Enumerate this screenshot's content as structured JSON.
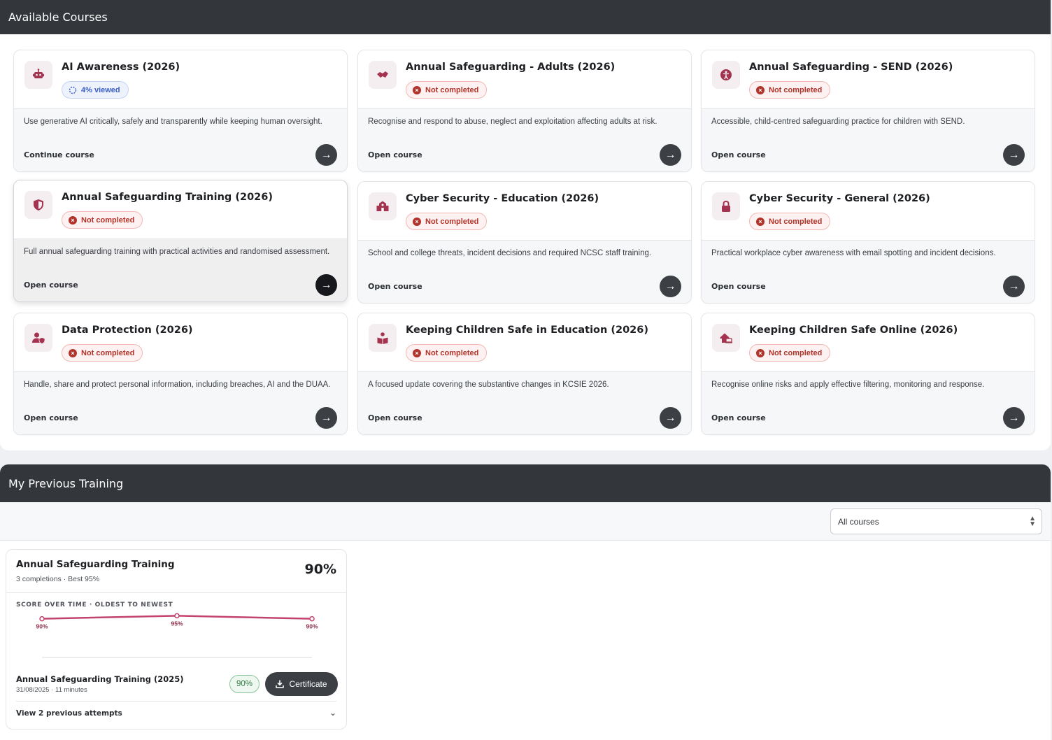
{
  "available": {
    "title": "Available Courses",
    "courses": [
      {
        "title": "AI Awareness (2026)",
        "status": "4% viewed",
        "status_type": "progress",
        "icon": "robot-icon",
        "description": "Use generative AI critically, safely and transparently while keeping human oversight.",
        "action": "Continue course"
      },
      {
        "title": "Annual Safeguarding - Adults (2026)",
        "status": "Not completed",
        "status_type": "not-completed",
        "icon": "handshake-icon",
        "description": "Recognise and respond to abuse, neglect and exploitation affecting adults at risk.",
        "action": "Open course"
      },
      {
        "title": "Annual Safeguarding - SEND (2026)",
        "status": "Not completed",
        "status_type": "not-completed",
        "icon": "accessibility-icon",
        "description": "Accessible, child-centred safeguarding practice for children with SEND.",
        "action": "Open course"
      },
      {
        "title": "Annual Safeguarding Training (2026)",
        "status": "Not completed",
        "status_type": "not-completed",
        "icon": "shield-icon",
        "description": "Full annual safeguarding training with practical activities and randomised assessment.",
        "action": "Open course"
      },
      {
        "title": "Cyber Security - Education (2026)",
        "status": "Not completed",
        "status_type": "not-completed",
        "icon": "school-icon",
        "description": "School and college threats, incident decisions and required NCSC staff training.",
        "action": "Open course"
      },
      {
        "title": "Cyber Security - General (2026)",
        "status": "Not completed",
        "status_type": "not-completed",
        "icon": "lock-icon",
        "description": "Practical workplace cyber awareness with email spotting and incident decisions.",
        "action": "Open course"
      },
      {
        "title": "Data Protection (2026)",
        "status": "Not completed",
        "status_type": "not-completed",
        "icon": "user-shield-icon",
        "description": "Handle, share and protect personal information, including breaches, AI and the DUAA.",
        "action": "Open course"
      },
      {
        "title": "Keeping Children Safe in Education (2026)",
        "status": "Not completed",
        "status_type": "not-completed",
        "icon": "book-reader-icon",
        "description": "A focused update covering the substantive changes in KCSIE 2026.",
        "action": "Open course"
      },
      {
        "title": "Keeping Children Safe Online (2026)",
        "status": "Not completed",
        "status_type": "not-completed",
        "icon": "house-laptop-icon",
        "description": "Recognise online risks and apply effective filtering, monitoring and response.",
        "action": "Open course"
      }
    ]
  },
  "previous": {
    "title": "My Previous Training",
    "filter": {
      "selected": "All courses"
    },
    "training": {
      "title": "Annual Safeguarding Training",
      "subtitle": "3 completions · Best 95%",
      "score": "90%",
      "chart_label": "SCORE OVER TIME · OLDEST TO NEWEST",
      "latest": {
        "title": "Annual Safeguarding Training (2025)",
        "meta": "31/08/2025 · 11 minutes",
        "score": "90%",
        "certificate_label": "Certificate"
      },
      "toggle_label": "View 2 previous attempts"
    }
  },
  "chart_data": {
    "type": "line",
    "title": "SCORE OVER TIME · OLDEST TO NEWEST",
    "x": [
      "attempt 1",
      "attempt 2",
      "attempt 3"
    ],
    "values": [
      90,
      95,
      90
    ],
    "data_labels": [
      "90%",
      "95%",
      "90%"
    ],
    "color": "#c2446e",
    "grid": false
  },
  "colors": {
    "header": "#33363b",
    "accent": "#a3334f",
    "not_completed": "#b2332a",
    "progress": "#3b5fc9",
    "score_good": "#2c7a3f"
  }
}
